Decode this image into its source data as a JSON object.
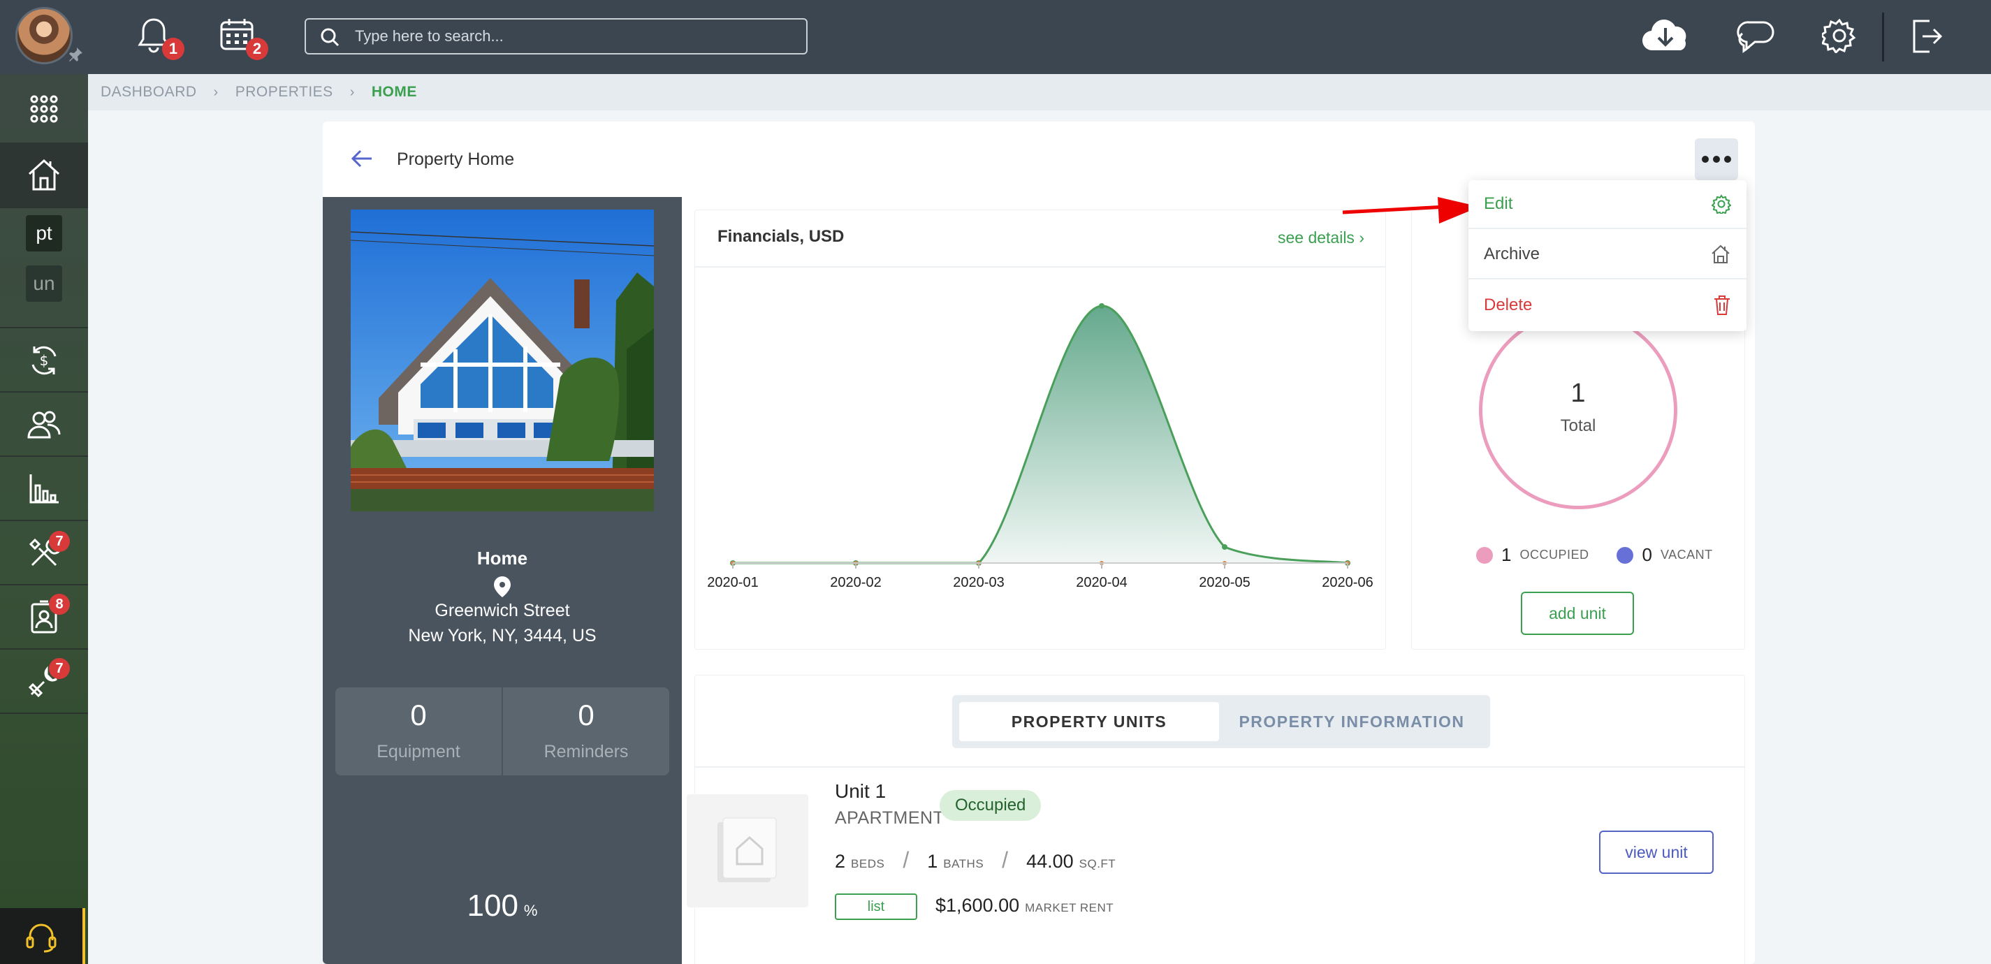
{
  "topbar": {
    "notifications_count": "1",
    "calendar_count": "2",
    "search_placeholder": "Type here to search..."
  },
  "sidebar": {
    "items": [
      {
        "icon": "apps-grid-icon"
      },
      {
        "icon": "property-house-icon",
        "active": true
      },
      {
        "label": "pt"
      },
      {
        "label": "un"
      },
      {
        "icon": "money-cycle-icon"
      },
      {
        "icon": "people-icon"
      },
      {
        "icon": "bar-chart-icon"
      },
      {
        "icon": "tools-icon",
        "badge": "7"
      },
      {
        "icon": "contact-card-icon",
        "badge": "8"
      },
      {
        "icon": "wrench-screwdriver-icon",
        "badge": "7"
      }
    ]
  },
  "breadcrumb": [
    "DASHBOARD",
    "PROPERTIES",
    "HOME"
  ],
  "page": {
    "title": "Property Home"
  },
  "property": {
    "name": "Home",
    "street": "Greenwich Street",
    "city_line": "New York, NY, 3444, US",
    "equipment_count": "0",
    "equipment_label": "Equipment",
    "reminders_count": "0",
    "reminders_label": "Reminders",
    "occupancy_pct": "100",
    "occupancy_unit": "%"
  },
  "financials": {
    "title": "Financials, USD",
    "link": "see details"
  },
  "chart_data": {
    "type": "area",
    "categories": [
      "2020-01",
      "2020-02",
      "2020-03",
      "2020-04",
      "2020-05",
      "2020-06"
    ],
    "series": [
      {
        "values": [
          0,
          0,
          0,
          1600,
          100,
          0
        ],
        "color": "#4aa05a"
      },
      {
        "values": [
          0,
          0,
          0,
          0,
          0,
          0
        ],
        "color": "#d9844a"
      }
    ],
    "ylim": [
      0,
      1600
    ]
  },
  "occupancy": {
    "total": "1",
    "total_label": "Total",
    "occupied_count": "1",
    "occupied_label": "OCCUPIED",
    "vacant_count": "0",
    "vacant_label": "VACANT",
    "occupied_color": "#ec9dbd",
    "vacant_color": "#6770d6",
    "add_unit_label": "add unit"
  },
  "tabs": [
    {
      "label": "PROPERTY UNITS",
      "active": true
    },
    {
      "label": "PROPERTY INFORMATION",
      "active": false
    }
  ],
  "unit": {
    "name": "Unit 1",
    "type": "APARTMENT",
    "status": "Occupied",
    "beds": "2",
    "beds_label": "BEDS",
    "baths": "1",
    "baths_label": "BATHS",
    "area": "44.00",
    "area_label": "SQ.FT",
    "list_label": "list",
    "rent": "$1,600.00",
    "rent_label": "MARKET RENT",
    "view_label": "view unit"
  },
  "menu": {
    "items": [
      {
        "label": "Edit",
        "color": "#3aa050",
        "icon": "gear-icon"
      },
      {
        "label": "Archive",
        "color": "#444444",
        "icon": "archive-house-icon"
      },
      {
        "label": "Delete",
        "color": "#d83a3a",
        "icon": "trash-icon"
      }
    ]
  },
  "colors": {
    "accent": "#3aa050",
    "topbar": "#3b4651",
    "danger": "#d83a3a"
  }
}
